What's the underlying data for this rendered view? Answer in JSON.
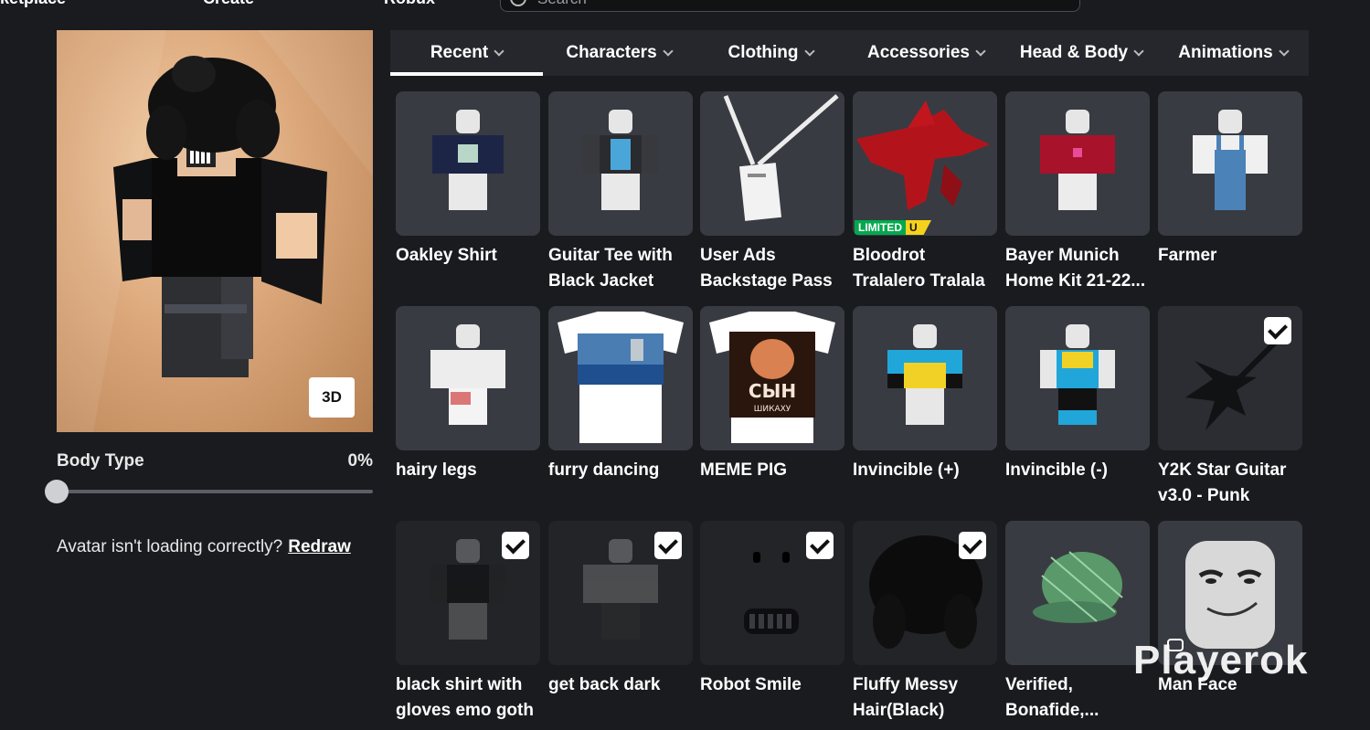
{
  "topbar": {
    "nav": [
      "ketplace",
      "Create",
      "Robux"
    ],
    "search_placeholder": "Search"
  },
  "avatar": {
    "view_button": "3D",
    "body_type_label": "Body Type",
    "body_type_value": "0%",
    "body_type_level": 0,
    "loading_text": "Avatar isn't loading correctly?",
    "redraw_link": "Redraw"
  },
  "tabs": [
    {
      "label": "Recent",
      "active": true
    },
    {
      "label": "Characters",
      "active": false
    },
    {
      "label": "Clothing",
      "active": false
    },
    {
      "label": "Accessories",
      "active": false
    },
    {
      "label": "Head & Body",
      "active": false
    },
    {
      "label": "Animations",
      "active": false
    }
  ],
  "items": [
    {
      "name": "Oakley Shirt",
      "thumb": "shirt-navy",
      "checked": false
    },
    {
      "name": "Guitar Tee with Black Jacket",
      "thumb": "shirt-jacket",
      "checked": false
    },
    {
      "name": "User Ads Backstage Pass",
      "thumb": "lanyard",
      "checked": false
    },
    {
      "name": "Bloodrot Tralalero Tralala",
      "thumb": "red-shark",
      "checked": false,
      "badge": "LIMITED",
      "badge_suffix": "U"
    },
    {
      "name": "Bayer Munich Home Kit 21-22...",
      "thumb": "shirt-red",
      "checked": false
    },
    {
      "name": "Farmer",
      "thumb": "overalls",
      "checked": false
    },
    {
      "name": "hairy legs",
      "thumb": "white-pants",
      "checked": false
    },
    {
      "name": "furry dancing",
      "thumb": "tshirt-car",
      "checked": false
    },
    {
      "name": "MEME PIG",
      "thumb": "tshirt-pig",
      "checked": false,
      "tshirt_text_1": "СЫН",
      "tshirt_text_2": "ШИКАХУ"
    },
    {
      "name": "Invincible (+)",
      "thumb": "invincible-plus",
      "checked": false
    },
    {
      "name": "Invincible (-)",
      "thumb": "invincible-minus",
      "checked": false
    },
    {
      "name": "Y2K Star Guitar v3.0 - Punk",
      "thumb": "star-guitar",
      "checked": true
    },
    {
      "name": "black shirt with gloves emo goth",
      "thumb": "black-shirt",
      "checked": true
    },
    {
      "name": "get back dark",
      "thumb": "dark-pants",
      "checked": true
    },
    {
      "name": "Robot Smile",
      "thumb": "robot-face",
      "checked": true
    },
    {
      "name": "Fluffy Messy Hair(Black)",
      "thumb": "black-hair",
      "checked": true
    },
    {
      "name": "Verified, Bonafide,...",
      "thumb": "green-cap",
      "checked": false
    },
    {
      "name": "Man Face",
      "thumb": "man-face",
      "checked": false
    }
  ],
  "watermark": "Playerok",
  "colors": {
    "background": "#191b1f",
    "card": "#393b42",
    "tabbar": "#25272c",
    "limited_green": "#03a84e",
    "limited_yellow": "#f7d21d"
  }
}
